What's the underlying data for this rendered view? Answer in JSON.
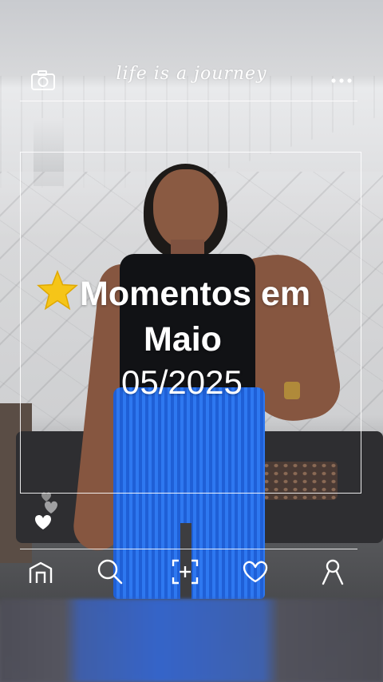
{
  "header": {
    "title": "life is a journey",
    "left_icon": "camera-icon",
    "right_icon": "more-dots-icon"
  },
  "caption": {
    "star_icon": "star-icon",
    "line1": "Momentos em",
    "line2": "Maio",
    "date": "05/2025"
  },
  "side_icons": [
    "hearts-icon"
  ],
  "nav": {
    "items": [
      "home-icon",
      "search-icon",
      "add-photo-icon",
      "heart-icon",
      "profile-icon"
    ]
  },
  "colors": {
    "overlay": "#ffffff",
    "star": "#f5c518"
  }
}
